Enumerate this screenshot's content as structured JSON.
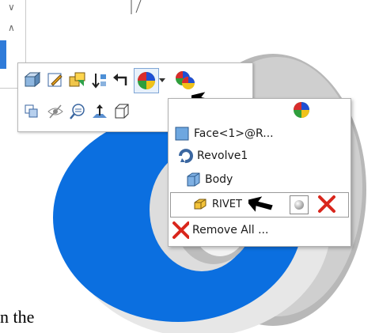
{
  "menu": {
    "items": [
      {
        "label": "Face<1>@R..."
      },
      {
        "label": "Revolve1"
      },
      {
        "label": "Body"
      },
      {
        "label": "RIVET"
      }
    ],
    "remove_all": "Remove All ..."
  },
  "caption": "n the",
  "icons": {
    "toolbar_row1": [
      "part-icon",
      "edit-sketch-icon",
      "insert-components-icon",
      "sort-icon",
      "back-arrow-icon",
      "appearance-icon",
      "appearance-dropdown-icon",
      "appearances-icon"
    ],
    "toolbar_row2": [
      "hide-show-icon",
      "eye-icon",
      "zoom-to-selection-icon",
      "normal-to-icon",
      "view-box-icon"
    ],
    "menu": [
      "appearance-ball-icon",
      "face-icon",
      "revolve-icon",
      "body-icon",
      "rivet-part-icon",
      "sphere-swatch-icon",
      "delete-x-icon",
      "remove-all-x-icon"
    ],
    "cursors": [
      "arrow-cursor"
    ]
  },
  "colors": {
    "accent_blue": "#0b6fe0",
    "delete_red": "#d9261c"
  }
}
